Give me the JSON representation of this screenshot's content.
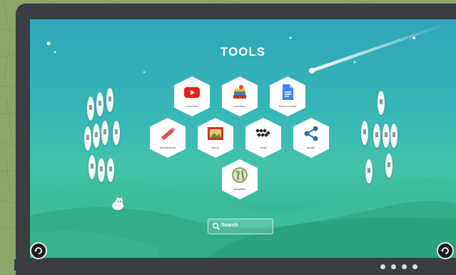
{
  "screen": {
    "title": "TOOLS"
  },
  "tools": [
    {
      "id": "youtube",
      "label": "YOUTUBE",
      "icon": "youtube-icon",
      "color": "#e62117"
    },
    {
      "id": "lessons",
      "label": "LESSONS",
      "icon": "books-icon",
      "color": "#c4623a"
    },
    {
      "id": "google-docs",
      "label": "GOOGLE DOCS",
      "icon": "google-docs-icon",
      "color": "#4285f4"
    },
    {
      "id": "whiteboard",
      "label": "WHITEBOARD",
      "icon": "pencil-icon",
      "color": "#d9534f"
    },
    {
      "id": "media",
      "label": "MEDIA",
      "icon": "picture-frame-icon",
      "color": "#c0392b"
    },
    {
      "id": "zoom",
      "label": "ZOOM",
      "icon": "clapperboard-icon",
      "color": "#222222"
    },
    {
      "id": "share",
      "label": "SHARE",
      "icon": "share-icon",
      "color": "#2e6da4"
    },
    {
      "id": "browser",
      "label": "BROWSER",
      "icon": "globe-icon",
      "color": "#6b8e4e"
    }
  ],
  "search": {
    "placeholder": "Search"
  },
  "pagination": {
    "pages": 4
  },
  "colors": {
    "frame": "#3a3d42",
    "sky_top": "#2fa6b8",
    "hill": "#2fae8a"
  }
}
